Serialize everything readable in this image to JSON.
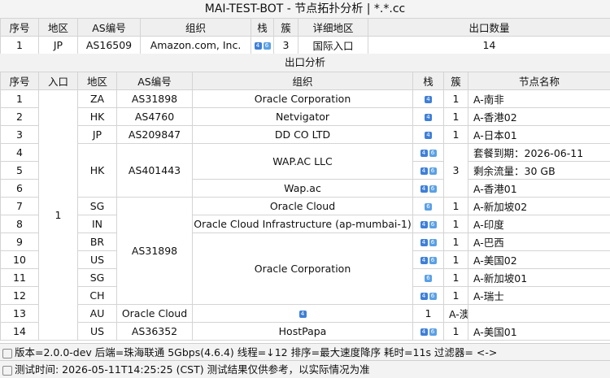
{
  "window": {
    "title": "MAI-TEST-BOT - 节点拓扑分析 | *.*.cc"
  },
  "summary": {
    "headers": [
      "序号",
      "地区",
      "AS编号",
      "组织",
      "栈",
      "簇",
      "详细地区",
      "出口数量"
    ],
    "row": {
      "index": "1",
      "region": "JP",
      "asn": "AS16509",
      "org": "Amazon.com, Inc.",
      "stack": [
        "4",
        "6"
      ],
      "cluster": "3",
      "detail": "国际入口",
      "exit_count": "14"
    }
  },
  "exits": {
    "section_title": "出口分析",
    "headers": [
      "序号",
      "入口",
      "地区",
      "AS编号",
      "组织",
      "栈",
      "簇",
      "节点名称"
    ],
    "entry": "1",
    "indices": [
      "1",
      "2",
      "3",
      "4",
      "5",
      "6",
      "7",
      "8",
      "9",
      "10",
      "11",
      "12",
      "13",
      "14"
    ],
    "regions": [
      "ZA",
      "HK",
      "JP",
      "HK",
      "SG",
      "IN",
      "BR",
      "US",
      "SG",
      "CH",
      "AU",
      "US"
    ],
    "asns": [
      "AS31898",
      "AS4760",
      "AS209847",
      "AS401443",
      "AS31898",
      "AS36352"
    ],
    "orgs": [
      "Oracle Corporation",
      "Netvigator",
      "DD CO LTD",
      "WAP.AC LLC",
      "Wap.ac",
      "Oracle Cloud",
      "Oracle Cloud Infrastructure (ap-mumbai-1)",
      "Oracle Corporation",
      "Oracle Cloud",
      "HostPapa"
    ],
    "stacks": [
      [
        "4"
      ],
      [
        "4"
      ],
      [
        "4"
      ],
      [
        "4",
        "6"
      ],
      [
        "4",
        "6"
      ],
      [
        "4",
        "6"
      ],
      [
        "6"
      ],
      [
        "4",
        "6"
      ],
      [
        "4",
        "6"
      ],
      [
        "4",
        "6"
      ],
      [
        "6"
      ],
      [
        "4",
        "6"
      ],
      [
        "4"
      ],
      [
        "4",
        "6"
      ]
    ],
    "clusters": [
      "1",
      "1",
      "1",
      "3",
      "1",
      "1",
      "1",
      "1",
      "1",
      "1",
      "1",
      "1"
    ],
    "names": [
      "A-南非",
      "A-香港02",
      "A-日本01",
      "套餐到期：2026-06-11",
      "剩余流量：30 GB",
      "A-香港01",
      "A-新加坡02",
      "A-印度",
      "A-巴西",
      "A-美国02",
      "A-新加坡01",
      "A-瑞士",
      "A-澳洲",
      "A-美国01"
    ]
  },
  "status": {
    "line1": "版本=2.0.0-dev  后端=珠海联通 5Gbps(4.6.4)  线程=↓12  排序=最大速度降序  耗时=11s  过滤器= <->",
    "line2": "测试时间: 2026-05-11T14:25:25 (CST)  测试结果仅供参考，以实际情况为准"
  },
  "colors": {
    "badge_v4": "#3f7fd6",
    "badge_v6": "#5aa0e6",
    "header_bg": "#efefef",
    "grid": "#d4d4d4"
  }
}
